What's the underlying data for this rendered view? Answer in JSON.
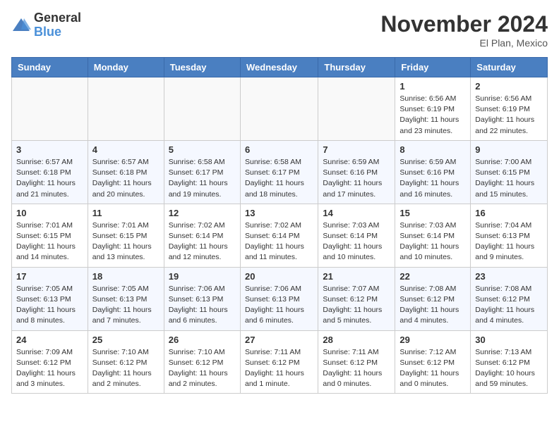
{
  "header": {
    "logo_general": "General",
    "logo_blue": "Blue",
    "month_title": "November 2024",
    "location": "El Plan, Mexico"
  },
  "weekdays": [
    "Sunday",
    "Monday",
    "Tuesday",
    "Wednesday",
    "Thursday",
    "Friday",
    "Saturday"
  ],
  "weeks": [
    [
      {
        "day": "",
        "info": ""
      },
      {
        "day": "",
        "info": ""
      },
      {
        "day": "",
        "info": ""
      },
      {
        "day": "",
        "info": ""
      },
      {
        "day": "",
        "info": ""
      },
      {
        "day": "1",
        "info": "Sunrise: 6:56 AM\nSunset: 6:19 PM\nDaylight: 11 hours and 23 minutes."
      },
      {
        "day": "2",
        "info": "Sunrise: 6:56 AM\nSunset: 6:19 PM\nDaylight: 11 hours and 22 minutes."
      }
    ],
    [
      {
        "day": "3",
        "info": "Sunrise: 6:57 AM\nSunset: 6:18 PM\nDaylight: 11 hours and 21 minutes."
      },
      {
        "day": "4",
        "info": "Sunrise: 6:57 AM\nSunset: 6:18 PM\nDaylight: 11 hours and 20 minutes."
      },
      {
        "day": "5",
        "info": "Sunrise: 6:58 AM\nSunset: 6:17 PM\nDaylight: 11 hours and 19 minutes."
      },
      {
        "day": "6",
        "info": "Sunrise: 6:58 AM\nSunset: 6:17 PM\nDaylight: 11 hours and 18 minutes."
      },
      {
        "day": "7",
        "info": "Sunrise: 6:59 AM\nSunset: 6:16 PM\nDaylight: 11 hours and 17 minutes."
      },
      {
        "day": "8",
        "info": "Sunrise: 6:59 AM\nSunset: 6:16 PM\nDaylight: 11 hours and 16 minutes."
      },
      {
        "day": "9",
        "info": "Sunrise: 7:00 AM\nSunset: 6:15 PM\nDaylight: 11 hours and 15 minutes."
      }
    ],
    [
      {
        "day": "10",
        "info": "Sunrise: 7:01 AM\nSunset: 6:15 PM\nDaylight: 11 hours and 14 minutes."
      },
      {
        "day": "11",
        "info": "Sunrise: 7:01 AM\nSunset: 6:15 PM\nDaylight: 11 hours and 13 minutes."
      },
      {
        "day": "12",
        "info": "Sunrise: 7:02 AM\nSunset: 6:14 PM\nDaylight: 11 hours and 12 minutes."
      },
      {
        "day": "13",
        "info": "Sunrise: 7:02 AM\nSunset: 6:14 PM\nDaylight: 11 hours and 11 minutes."
      },
      {
        "day": "14",
        "info": "Sunrise: 7:03 AM\nSunset: 6:14 PM\nDaylight: 11 hours and 10 minutes."
      },
      {
        "day": "15",
        "info": "Sunrise: 7:03 AM\nSunset: 6:14 PM\nDaylight: 11 hours and 10 minutes."
      },
      {
        "day": "16",
        "info": "Sunrise: 7:04 AM\nSunset: 6:13 PM\nDaylight: 11 hours and 9 minutes."
      }
    ],
    [
      {
        "day": "17",
        "info": "Sunrise: 7:05 AM\nSunset: 6:13 PM\nDaylight: 11 hours and 8 minutes."
      },
      {
        "day": "18",
        "info": "Sunrise: 7:05 AM\nSunset: 6:13 PM\nDaylight: 11 hours and 7 minutes."
      },
      {
        "day": "19",
        "info": "Sunrise: 7:06 AM\nSunset: 6:13 PM\nDaylight: 11 hours and 6 minutes."
      },
      {
        "day": "20",
        "info": "Sunrise: 7:06 AM\nSunset: 6:13 PM\nDaylight: 11 hours and 6 minutes."
      },
      {
        "day": "21",
        "info": "Sunrise: 7:07 AM\nSunset: 6:12 PM\nDaylight: 11 hours and 5 minutes."
      },
      {
        "day": "22",
        "info": "Sunrise: 7:08 AM\nSunset: 6:12 PM\nDaylight: 11 hours and 4 minutes."
      },
      {
        "day": "23",
        "info": "Sunrise: 7:08 AM\nSunset: 6:12 PM\nDaylight: 11 hours and 4 minutes."
      }
    ],
    [
      {
        "day": "24",
        "info": "Sunrise: 7:09 AM\nSunset: 6:12 PM\nDaylight: 11 hours and 3 minutes."
      },
      {
        "day": "25",
        "info": "Sunrise: 7:10 AM\nSunset: 6:12 PM\nDaylight: 11 hours and 2 minutes."
      },
      {
        "day": "26",
        "info": "Sunrise: 7:10 AM\nSunset: 6:12 PM\nDaylight: 11 hours and 2 minutes."
      },
      {
        "day": "27",
        "info": "Sunrise: 7:11 AM\nSunset: 6:12 PM\nDaylight: 11 hours and 1 minute."
      },
      {
        "day": "28",
        "info": "Sunrise: 7:11 AM\nSunset: 6:12 PM\nDaylight: 11 hours and 0 minutes."
      },
      {
        "day": "29",
        "info": "Sunrise: 7:12 AM\nSunset: 6:12 PM\nDaylight: 11 hours and 0 minutes."
      },
      {
        "day": "30",
        "info": "Sunrise: 7:13 AM\nSunset: 6:12 PM\nDaylight: 10 hours and 59 minutes."
      }
    ]
  ]
}
